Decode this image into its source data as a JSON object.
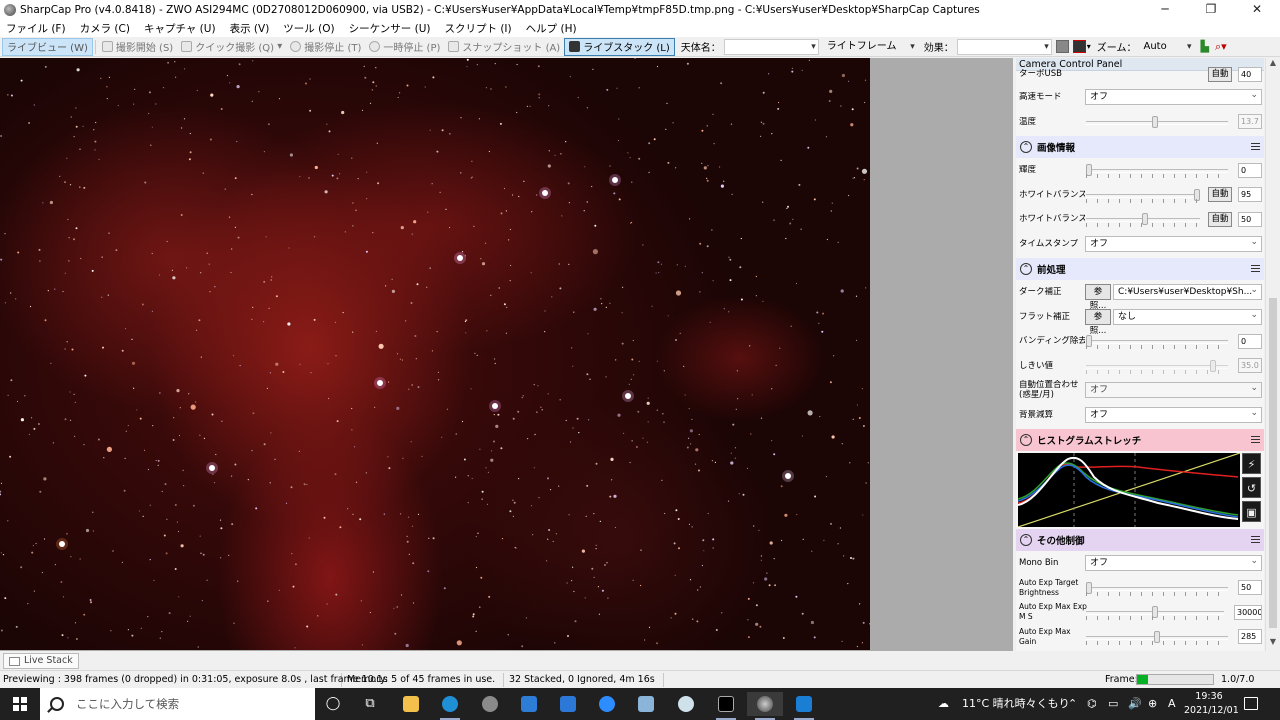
{
  "window": {
    "title": "SharpCap Pro (v4.0.8418) - ZWO ASI294MC (0D2708012D060900, via USB2) - C:¥Users¥user¥AppData¥Local¥Temp¥tmpF85D.tmp.png - C:¥Users¥user¥Desktop¥SharpCap Captures",
    "minimize": "─",
    "maximize": "❐",
    "close": "✕"
  },
  "menu": [
    "ファイル (F)",
    "カメラ (C)",
    "キャプチャ (U)",
    "表示 (V)",
    "ツール (O)",
    "シーケンサー (U)",
    "スクリプト (I)",
    "ヘルプ (H)"
  ],
  "toolbar": {
    "live_view": "ライブビュー (W)",
    "start_capture": "撮影開始 (S)",
    "quick_capture": "クイック撮影 (Q)",
    "stop_capture": "撮影停止 (T)",
    "pause": "一時停止 (P)",
    "snapshot": "スナップショット (A)",
    "live_stack": "ライブスタック (L)",
    "object_label": "天体名：",
    "object_value": "",
    "frame_type": "ライトフレーム",
    "effect_label": "効果：",
    "effect_value": "",
    "zoom_label": "ズーム：",
    "zoom_value": "Auto"
  },
  "panel": {
    "title": "Camera Control Panel",
    "pin": "⊕",
    "top_rows": [
      {
        "label": "ターボUSB",
        "auto": "自動",
        "value": "40"
      },
      {
        "label": "高速モード",
        "select": "オフ"
      },
      {
        "label": "温度",
        "value": "13.7"
      }
    ],
    "image_info": {
      "title": "画像情報",
      "brightness": {
        "label": "輝度",
        "value": "0"
      },
      "wb_r": {
        "label": "ホワイトバランス(R)",
        "auto": "自動",
        "value": "95"
      },
      "wb_b": {
        "label": "ホワイトバランス(B)",
        "auto": "自動",
        "value": "50"
      },
      "timestamp": {
        "label": "タイムスタンプ",
        "select": "オフ"
      }
    },
    "preprocess": {
      "title": "前処理",
      "dark": {
        "label": "ダーク補正",
        "browse": "参照...",
        "select": "C:¥Users¥user¥Desktop¥Sh..."
      },
      "flat": {
        "label": "フラット補正",
        "browse": "参照...",
        "select": "なし"
      },
      "banding": {
        "label": "バンディング除去",
        "value": "0"
      },
      "threshold": {
        "label": "しきい値",
        "value": "35.0"
      },
      "auto_align": {
        "label": "自動位置合わせ (惑星/月)",
        "select": "オフ"
      },
      "bg_sub": {
        "label": "背景減算",
        "select": "オフ"
      }
    },
    "histogram": {
      "title": "ヒストグラムストレッチ",
      "btn1": "⚡",
      "btn2": "↺",
      "btn3": "▣"
    },
    "other": {
      "title": "その他制御",
      "mono_bin": {
        "label": "Mono Bin",
        "select": "オフ"
      },
      "auto_exp_target": {
        "label": "Auto Exp Target Brightness",
        "value": "50"
      },
      "auto_exp_max_ms": {
        "label": "Auto Exp Max Exp M S",
        "value": "30000"
      },
      "auto_exp_max_gain": {
        "label": "Auto Exp Max Gain",
        "value": "285"
      }
    }
  },
  "bottom_tab": "Live Stack",
  "status": {
    "preview": "Previewing : 398 frames (0 dropped) in 0:31:05, exposure 8.0s , last frame 10.1s",
    "memory": "Memory: 5 of 45 frames in use.",
    "stacked": "32 Stacked, 0 Ignored, 4m 16s",
    "frame_label": "Frame:",
    "frame_progress": 0.14,
    "frame_value": "1.0/7.0"
  },
  "taskbar": {
    "search_placeholder": "ここに入力して検索",
    "weather": "11°C  晴れ時々くもり",
    "ime": "A",
    "time": "19:36",
    "date": "2021/12/01"
  },
  "colors": {
    "title_bg": "#ffffff",
    "histo_bg": "#000000",
    "accent_green": "#06b025"
  }
}
